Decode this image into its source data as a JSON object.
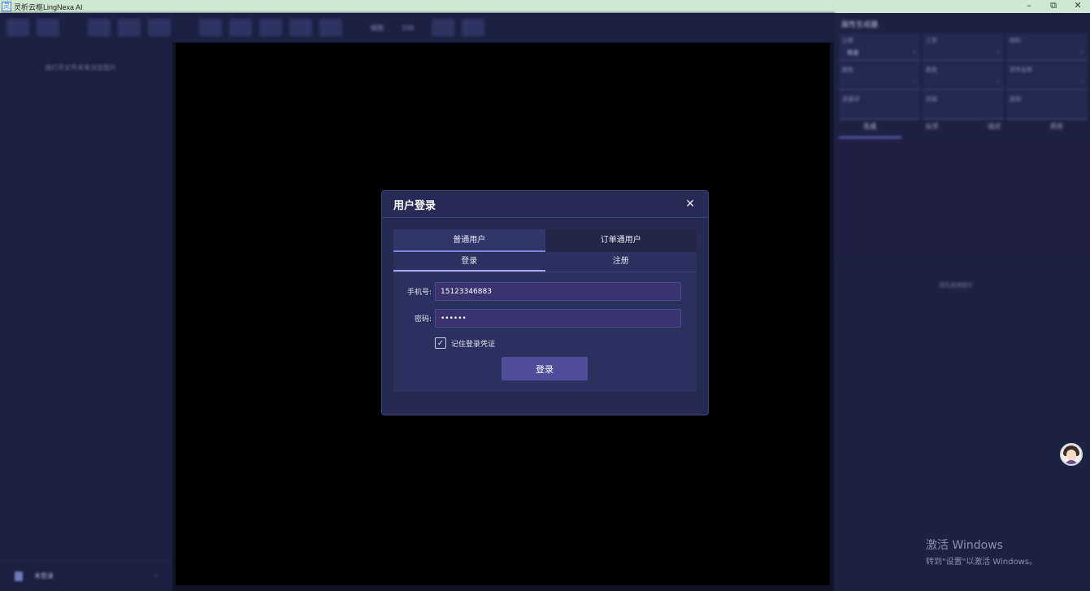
{
  "window": {
    "title": "灵析云枢LingNexa AI",
    "minimize": "–",
    "restore": "⧉",
    "close": "✕"
  },
  "sidebar": {
    "hint": "请打开文件夹来浏览图片",
    "bottom_label": "未登录",
    "bottom_chevron": "›"
  },
  "toolbar": {
    "zoom_label": "缩放",
    "zoom_value": "100"
  },
  "right_panel": {
    "title": "属性生成器",
    "fields": [
      {
        "label": "分类",
        "value": "普通"
      },
      {
        "label": "工艺",
        "value": ""
      },
      {
        "label": "材料",
        "value": ""
      },
      {
        "label": "颜色",
        "value": ""
      },
      {
        "label": "款型",
        "value": ""
      },
      {
        "label": "货号名称",
        "value": ""
      },
      {
        "label": "关键词",
        "value": ""
      },
      {
        "label": "风格",
        "value": ""
      },
      {
        "label": "其他",
        "value": ""
      }
    ],
    "tabs": [
      "生成",
      "标签",
      "描述",
      "其他"
    ],
    "empty_hint": "请先选择图片"
  },
  "watermark": {
    "line1": "激活 Windows",
    "line2": "转到\"设置\"以激活 Windows。"
  },
  "dialog": {
    "title": "用户登录",
    "close": "✕",
    "user_tabs": [
      "普通用户",
      "订单通用户"
    ],
    "mode_tabs": [
      "登录",
      "注册"
    ],
    "phone_label": "手机号:",
    "phone_value": "15123346883",
    "password_label": "密码:",
    "password_value": "••••••",
    "remember_label": "记住登录凭证",
    "remember_checked": "✓",
    "login_button": "登录"
  },
  "colors": {
    "background": "#161c33",
    "dialog": "#252a52",
    "accent": "#4e4d9a",
    "input": "#3a3370"
  }
}
